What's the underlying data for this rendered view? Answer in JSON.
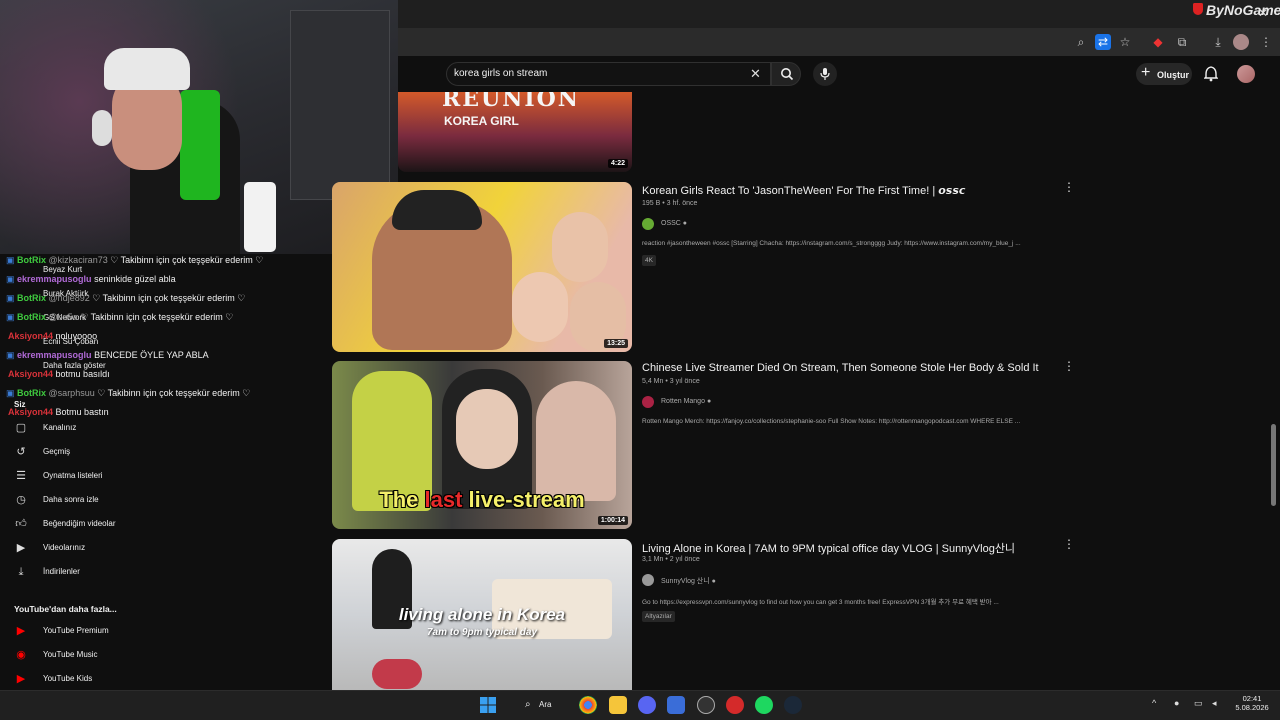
{
  "watermark": "ByNoGame",
  "search": {
    "query": "korea girls on stream"
  },
  "header": {
    "create_label": "Oluştur"
  },
  "chat": [
    {
      "user": "BotRix",
      "mention": "@kizkaciran73",
      "text": "♡ Takibinn için çok teşşekür ederim ♡",
      "user_color": "#3fca3f"
    },
    {
      "user": "ekremmapusoglu",
      "text": "seninkide güzel abla",
      "user_color": "#b06ad6"
    },
    {
      "user": "BotRix",
      "mention": "@hdje892",
      "text": "♡ Takibinn için çok teşşekür ederim ♡",
      "user_color": "#3fca3f"
    },
    {
      "user": "BotRix",
      "mention": "@bu5a",
      "text": "♡ Takibinn için çok teşşekür ederim ♡",
      "user_color": "#3fca3f"
    },
    {
      "user": "Aksiyon44",
      "text": "noluyoooo",
      "user_color": "#d9323a"
    },
    {
      "user": "ekremmapusoglu",
      "text": "BENCEDE ÖYLE YAP ABLA",
      "user_color": "#b06ad6"
    },
    {
      "user": "Aksiyon44",
      "text": "botmu basıldı",
      "user_color": "#d9323a"
    },
    {
      "user": "BotRix",
      "mention": "@sarphsuu",
      "text": "♡ Takibinn için çok teşşekür ederim ♡",
      "user_color": "#3fca3f"
    },
    {
      "user": "Aksiyon44",
      "text": "Botmu bastın",
      "user_color": "#d9323a"
    }
  ],
  "ghost_subs": [
    "Beyaz Kurt",
    "Burak Aktürk",
    "GS Network",
    "Ecnii Su Çoban",
    "Daha fazla göster"
  ],
  "sidebar": {
    "you_label": "Siz",
    "items": [
      {
        "label": "Kanalınız",
        "icon": "channel-icon"
      },
      {
        "label": "Geçmiş",
        "icon": "history-icon"
      },
      {
        "label": "Oynatma listeleri",
        "icon": "playlist-icon"
      },
      {
        "label": "Daha sonra izle",
        "icon": "clock-icon"
      },
      {
        "label": "Beğendiğim videolar",
        "icon": "thumbs-up-icon"
      },
      {
        "label": "Videolarınız",
        "icon": "video-icon"
      },
      {
        "label": "İndirilenler",
        "icon": "download-icon"
      }
    ],
    "more_label": "YouTube'dan daha fazla...",
    "more_items": [
      {
        "label": "YouTube Premium"
      },
      {
        "label": "YouTube Music"
      },
      {
        "label": "YouTube Kids"
      }
    ]
  },
  "videos": [
    {
      "thumb_text_1": "REUNION",
      "thumb_text_2": "KOREA GIRL",
      "duration": "4:22"
    },
    {
      "title": "Korean Girls React To 'JasonTheWeen' For The First Time! | 𝙤𝙨𝙨𝙘",
      "views": "195 B",
      "age": "3 hf. önce",
      "channel": "OSSC",
      "desc": "reaction #jasontheween #ossc [Starring] Chacha: https://instagram.com/s_strongggg Judy: https://www.instagram.com/my_blue_j ...",
      "badge": "4K",
      "duration": "13:25"
    },
    {
      "title": "Chinese Live Streamer Died On Stream, Then Someone Stole Her Body & Sold It",
      "views": "5,4 Mn",
      "age": "3 yıl önce",
      "channel": "Rotten Mango",
      "desc": "Rotten Mango Merch: https://fanjoy.co/collections/stephanie-soo Full Show Notes: http://rottenmangopodcast.com WHERE ELSE ...",
      "thumb_caption_a": "The ",
      "thumb_caption_b": "last",
      "thumb_caption_c": " live-stream",
      "duration": "1:00:14"
    },
    {
      "title": "Living Alone in Korea | 7AM to 9PM typical office day VLOG | SunnyVlog산니",
      "views": "3,1 Mn",
      "age": "2 yıl önce",
      "channel": "SunnyVlog 산니",
      "desc": "Go to https://expressvpn.com/sunnyvlog to find out how you can get 3 months free! ExpressVPN 3개월 추가 무료 혜택 받아 ...",
      "badge": "Altyazılar",
      "thumb_caption_1": "living alone in Korea",
      "thumb_caption_2": "7am to 9pm typical day"
    }
  ],
  "taskbar": {
    "search_label": "Ara",
    "time": "02:41",
    "date": "5.08.2026"
  }
}
